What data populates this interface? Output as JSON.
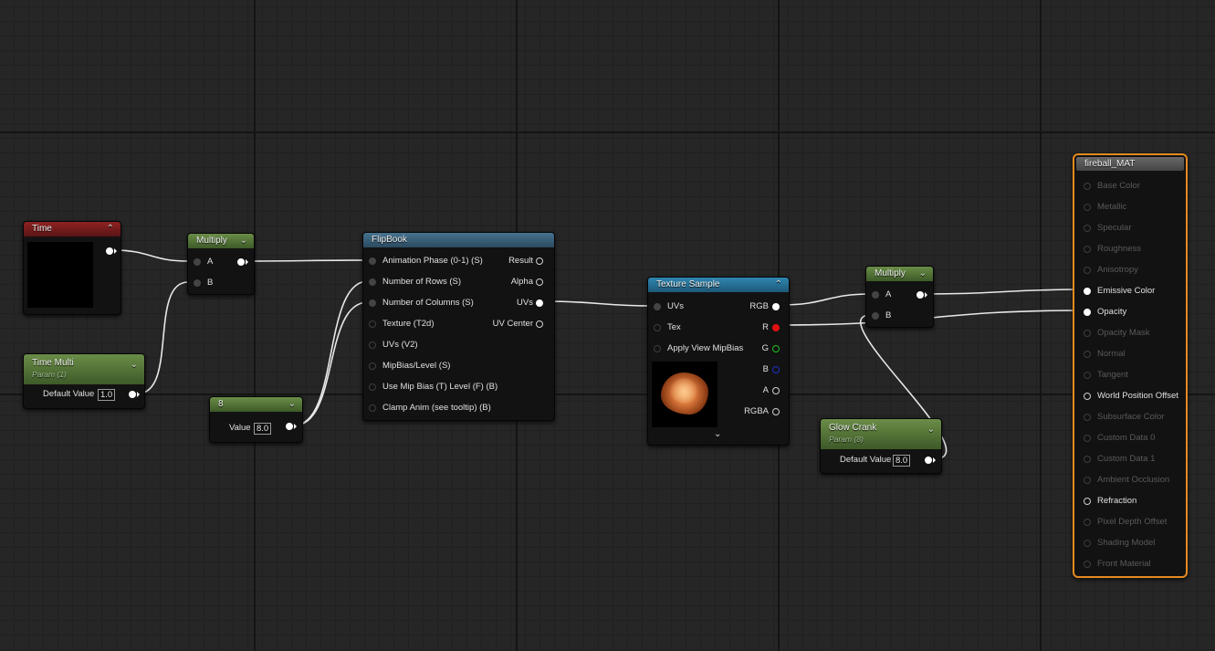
{
  "colors": {
    "canvas": "#262626",
    "param_header": "#5a7d3a",
    "time_header": "#7a1c1c",
    "flipbook_header": "#3b6480",
    "texture_header": "#2677a0",
    "result_header": "#565656",
    "result_border": "#e58a1f",
    "r_channel": "#e01010",
    "g_channel": "#20c020",
    "b_channel": "#2030d0"
  },
  "nodes": {
    "time": {
      "title": "Time",
      "icon": "chevron-up-icon"
    },
    "multiply1": {
      "title": "Multiply",
      "icon": "chevron-down-icon",
      "inputs": [
        "A",
        "B"
      ]
    },
    "time_multi": {
      "title": "Time Multi",
      "subtitle": "Param (1)",
      "icon": "chevron-down-icon",
      "field_label": "Default Value",
      "value": "1.0"
    },
    "const8": {
      "title": "8",
      "icon": "chevron-down-icon",
      "field_label": "Value",
      "value": "8.0"
    },
    "flipbook": {
      "title": "FlipBook",
      "inputs": [
        "Animation  Phase (0-1) (S)",
        "Number of Rows (S)",
        "Number of Columns (S)",
        "Texture (T2d)",
        "UVs (V2)",
        "MipBias/Level (S)",
        "Use Mip Bias (T) Level (F) (B)",
        "Clamp Anim (see tooltip) (B)"
      ],
      "outputs": [
        "Result",
        "Alpha",
        "UVs",
        "UV Center"
      ]
    },
    "texture_sample": {
      "title": "Texture Sample",
      "icon": "chevron-up-icon",
      "expand_icon": "chevron-down-icon",
      "inputs": [
        "UVs",
        "Tex",
        "Apply View MipBias"
      ],
      "outputs": [
        "RGB",
        "R",
        "G",
        "B",
        "A",
        "RGBA"
      ]
    },
    "multiply2": {
      "title": "Multiply",
      "icon": "chevron-down-icon",
      "inputs": [
        "A",
        "B"
      ]
    },
    "glow_crank": {
      "title": "Glow Crank",
      "subtitle": "Param (8)",
      "icon": "chevron-down-icon",
      "field_label": "Default Value",
      "value": "8.0"
    },
    "material": {
      "title": "fireball_MAT",
      "inputs": [
        {
          "label": "Base Color",
          "active": false
        },
        {
          "label": "Metallic",
          "active": false
        },
        {
          "label": "Specular",
          "active": false
        },
        {
          "label": "Roughness",
          "active": false
        },
        {
          "label": "Anisotropy",
          "active": false
        },
        {
          "label": "Emissive Color",
          "active": true
        },
        {
          "label": "Opacity",
          "active": true
        },
        {
          "label": "Opacity Mask",
          "active": false
        },
        {
          "label": "Normal",
          "active": false
        },
        {
          "label": "Tangent",
          "active": false
        },
        {
          "label": "World Position Offset",
          "active": true
        },
        {
          "label": "Subsurface Color",
          "active": false
        },
        {
          "label": "Custom Data 0",
          "active": false
        },
        {
          "label": "Custom Data 1",
          "active": false
        },
        {
          "label": "Ambient Occlusion",
          "active": false
        },
        {
          "label": "Refraction",
          "active": true
        },
        {
          "label": "Pixel Depth Offset",
          "active": false
        },
        {
          "label": "Shading Model",
          "active": false
        },
        {
          "label": "Front Material",
          "active": false
        }
      ]
    }
  }
}
